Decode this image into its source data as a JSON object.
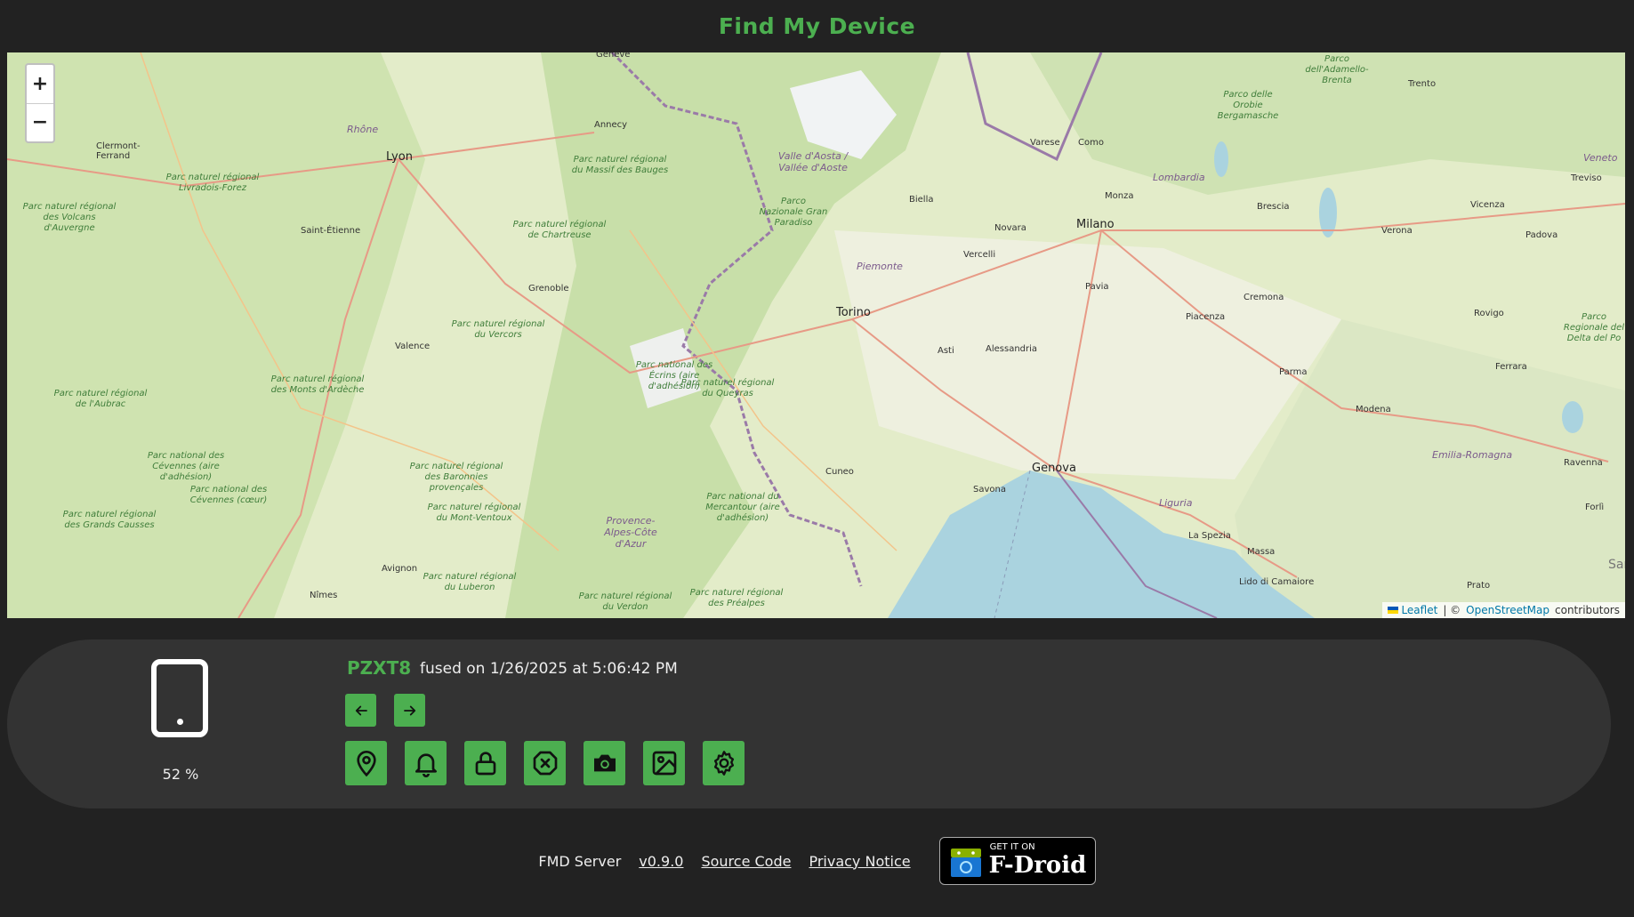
{
  "header": {
    "title": "Find My Device"
  },
  "map": {
    "zoom_in": "+",
    "zoom_out": "−",
    "cities": [
      "Lyon",
      "Torino",
      "Milano",
      "Genova",
      "Grenoble",
      "Annecy",
      "Saint-Étienne",
      "Valence",
      "Cuneo",
      "Savona",
      "Novara",
      "Vercelli",
      "Biella",
      "Asti",
      "Alessandria",
      "Pavia",
      "Piacenza",
      "Cremona",
      "Brescia",
      "Verona",
      "Vicenza",
      "Padova",
      "Parma",
      "Modena",
      "Ferrara",
      "Rovigo",
      "Trento",
      "Treviso",
      "Ravenna",
      "Forlì",
      "Prato",
      "La Spezia",
      "Massa",
      "Lido di Camaiore",
      "Monza",
      "Como",
      "Varese",
      "Avignon",
      "Nîmes",
      "Clermont-Ferrand",
      "Genève"
    ],
    "regions": [
      "Piemonte",
      "Lombardia",
      "Liguria",
      "Emilia-Romagna",
      "Veneto",
      "Valle d'Aosta / Vallée d'Aoste",
      "Provence-Alpes-Côte d'Azur",
      "Rhône"
    ],
    "parks": [
      "Parc naturel régional des Volcans d'Auvergne",
      "Parc naturel régional Livradois-Forez",
      "Parc naturel régional du Massif des Bauges",
      "Parc naturel régional de Chartreuse",
      "Parc naturel régional du Vercors",
      "Parc naturel régional des Monts d'Ardèche",
      "Parc naturel régional de l'Aubrac",
      "Parc national des Cévennes (aire d'adhésion)",
      "Parc national des Cévennes (cœur)",
      "Parc naturel régional des Grands Causses",
      "Parc naturel régional des Baronnies provençales",
      "Parc naturel régional du Mont-Ventoux",
      "Parc naturel régional du Luberon",
      "Parc national des Écrins (aire d'adhésion)",
      "Parc naturel régional du Queyras",
      "Parc national du Mercantour (aire d'adhésion)",
      "Parc naturel régional du Verdon",
      "Parc naturel régional des Préalpes",
      "Parco Nazionale Gran Paradiso",
      "Parco delle Orobie Bergamasche",
      "Parco dell'Adamello-Brenta",
      "Parco Regionale del Delta del Po"
    ],
    "edge_label": "San",
    "attribution": {
      "leaflet": "Leaflet",
      "sep": "| ©",
      "osm": "OpenStreetMap",
      "contributors": "contributors"
    }
  },
  "device": {
    "name": "PZXT8",
    "info": "fused on 1/26/2025 at 5:06:42 PM",
    "battery": "52 %",
    "buttons": [
      "prev-location",
      "next-location",
      "locate",
      "ring",
      "lock",
      "delete",
      "camera",
      "pictures",
      "settings"
    ]
  },
  "footer": {
    "server": "FMD Server",
    "version": "v0.9.0",
    "source": "Source Code",
    "privacy": "Privacy Notice",
    "badge_get": "GET IT ON",
    "badge_name": "F-Droid"
  },
  "colors": {
    "accent": "#4caf50",
    "background": "#222222",
    "panel": "#333333"
  }
}
